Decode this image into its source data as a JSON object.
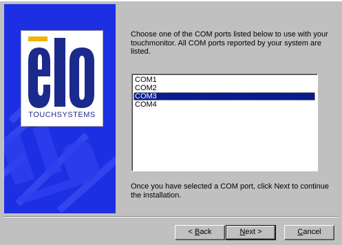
{
  "banner": {
    "logo_text": "elo",
    "logo_subtitle": "TOUCHSYSTEMS",
    "colors": {
      "background": "#1d2fe3",
      "logo_blue": "#1b2a8d",
      "logo_bar": "#f0b400"
    }
  },
  "instructions": "Choose one of the COM ports listed below to use with your touchmonitor. All COM ports reported by your system are listed.",
  "com_ports": [
    {
      "label": "COM1",
      "selected": false
    },
    {
      "label": "COM2",
      "selected": false
    },
    {
      "label": "COM3",
      "selected": true
    },
    {
      "label": "COM4",
      "selected": false
    }
  ],
  "after_text": "Once you have selected a COM port, click Next to continue the installation.",
  "buttons": {
    "back": {
      "label": "Back",
      "prefix": "< ",
      "mnemonic": "B"
    },
    "next": {
      "label": "Next",
      "suffix": " >",
      "mnemonic": "N"
    },
    "cancel": {
      "label": "Cancel",
      "mnemonic": "C"
    }
  },
  "colors": {
    "dialog": "#c0c0c0",
    "selection": "#0a1c8f"
  }
}
